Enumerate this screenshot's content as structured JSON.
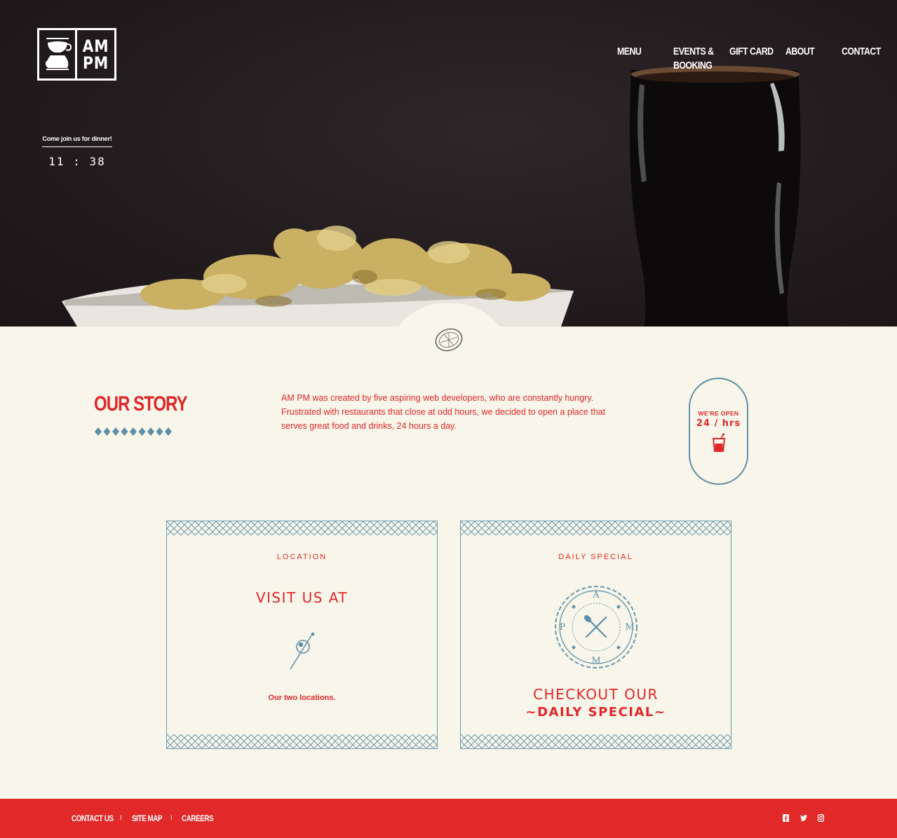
{
  "brand": {
    "line1": "AM",
    "line2": "PM"
  },
  "nav": {
    "menu": "MENU",
    "events_line1": "EVENTS &",
    "events_line2": "BOOKING",
    "gift_card": "GIFT CARD",
    "about": "ABOUT",
    "contact": "CONTACT"
  },
  "hero": {
    "tagline": "Come join us for dinner!",
    "clock": "11 : 38"
  },
  "story": {
    "title": "OUR STORY",
    "body": "AM PM was created by five aspiring web developers, who are constantly hungry. Frustrated with restaurants that close at odd hours, we decided to open a place that serves great food and drinks, 24 hours a day.",
    "badge_line1": "WE'RE OPEN",
    "badge_line2": "24 / hrs"
  },
  "cards": {
    "location": {
      "eyebrow": "LOCATION",
      "heading": "VISIT US AT",
      "link": "Our two locations."
    },
    "special": {
      "eyebrow": "DAILY SPECIAL",
      "heading_line1": "CHECKOUT OUR",
      "heading_line2": "~DAILY SPECIAL~",
      "seal_letters": {
        "top": "A",
        "left": "P",
        "right": "M",
        "bottom": "M"
      }
    }
  },
  "footer": {
    "links": [
      "CONTACT US",
      "SITE MAP",
      "CAREERS"
    ],
    "separator": "I",
    "social": [
      "facebook-icon",
      "twitter-icon",
      "instagram-icon"
    ]
  },
  "colors": {
    "accent_red": "#e0272a",
    "accent_blue": "#5f8fa8",
    "cream": "#f8f6ea",
    "hero_dark": "#231c1f",
    "footer_red": "#e1292a"
  }
}
